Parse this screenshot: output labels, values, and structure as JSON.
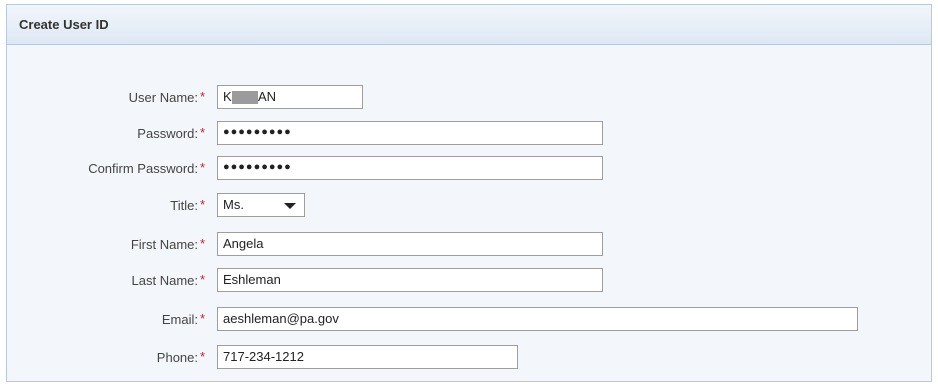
{
  "form": {
    "title": "Create User ID",
    "required_marker": "*",
    "user_name": {
      "label": "User Name:",
      "value_start": "K",
      "value_end": "AN"
    },
    "password": {
      "label": "Password:",
      "value": "●●●●●●●●●"
    },
    "confirm_password": {
      "label": "Confirm Password:",
      "value": "●●●●●●●●●"
    },
    "title_field": {
      "label": "Title:",
      "value": "Ms."
    },
    "first_name": {
      "label": "First Name:",
      "value": "Angela"
    },
    "last_name": {
      "label": "Last Name:",
      "value": "Eshleman"
    },
    "email": {
      "label": "Email:",
      "value": "aeshleman@pa.gov"
    },
    "phone": {
      "label": "Phone:",
      "value": "717-234-1212"
    }
  },
  "colors": {
    "required": "#cc2222",
    "header_bg": "#dde8f4",
    "panel_bg": "#f3f6fa",
    "border": "#b9c9dc"
  },
  "icons": {
    "dropdown": "chevron-down-icon"
  }
}
